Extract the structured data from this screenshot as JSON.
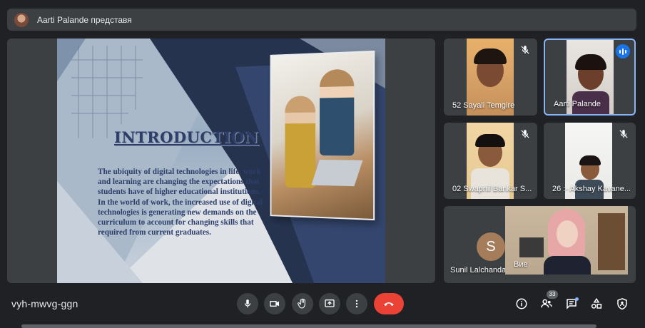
{
  "presenter": {
    "text": "Aarti Palande представя"
  },
  "slide": {
    "title": "INTRODUCTION",
    "paragraphs": [
      "The ubiquity of digital technologies in life, work and learning are changing the expectations that students have of higher educational institutions.",
      "In the world of  work, the increased use of digital technologies is generating new demands on the curriculum to account for changing skills that required from current graduates."
    ]
  },
  "participants": [
    {
      "name": "52 Sayali Temgire",
      "muted": true
    },
    {
      "name": "Aarti Palande",
      "speaking": true
    },
    {
      "name": "02 Swapnil Bankar S...",
      "muted": true
    },
    {
      "name": "26 :- Akshay Kavane...",
      "muted": true
    },
    {
      "name": "Sunil Lalchandani",
      "avatar_letter": "S",
      "avatar_color": "#a57d5b"
    },
    {
      "name": "Вие"
    }
  ],
  "meeting": {
    "code": "vyh-mwvg-ggn"
  },
  "people_count": "33",
  "controls": {
    "mic": "mic-icon",
    "camera": "camera-icon",
    "raise_hand": "hand-icon",
    "present": "present-icon",
    "more": "more-vert-icon",
    "end_call": "call-end-icon"
  },
  "right_controls": [
    "info-icon",
    "people-icon",
    "chat-icon",
    "activities-icon",
    "host-controls-icon"
  ],
  "colors": {
    "background": "#202124",
    "tile": "#3c4043",
    "accent": "#1a73e8",
    "end_call": "#ea4335"
  }
}
